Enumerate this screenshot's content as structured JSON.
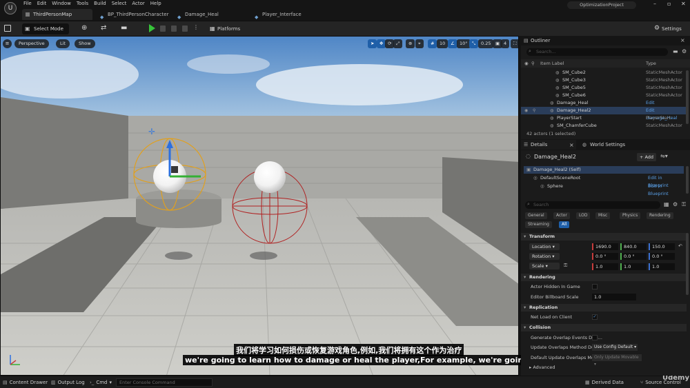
{
  "menu": [
    "File",
    "Edit",
    "Window",
    "Tools",
    "Build",
    "Select",
    "Actor",
    "Help"
  ],
  "map_tab": "ThirdPersonMap",
  "doc_tabs": [
    "BP_ThirdPersonCharacter",
    "Damage_Heal",
    "Player_Interface"
  ],
  "project_name": "OptimizationProject",
  "toolbar": {
    "select_mode": "Select Mode",
    "platforms": "Platforms",
    "settings": "Settings"
  },
  "viewport": {
    "view_mode": "Perspective",
    "lit": "Lit",
    "show": "Show",
    "grid_snap": "10",
    "rot_snap": "10°",
    "scale_snap": "0.25",
    "cam_speed": "4"
  },
  "subtitles": {
    "chinese": "我们将学习如何损伤或恢复游戏角色,例如,我们将拥有这个作为治疗",
    "english": "we're going to learn how to damage or heal the player,For example, we're going to h"
  },
  "statusbar": {
    "content_drawer": "Content Drawer",
    "output_log": "Output Log",
    "cmd": "Cmd",
    "console_placeholder": "Enter Console Command",
    "derived_data": "Derived Data",
    "source_control": "Source Control",
    "watermark": "Udemy"
  },
  "outliner": {
    "title": "Outliner",
    "search_placeholder": "Search...",
    "col_label": "Item Label",
    "col_type": "Type",
    "rows": [
      {
        "name": "SM_Cube2",
        "type": "StaticMeshActor",
        "indent": 2,
        "selected": false,
        "link": false
      },
      {
        "name": "SM_Cube3",
        "type": "StaticMeshActor",
        "indent": 2,
        "selected": false,
        "link": false
      },
      {
        "name": "SM_Cube5",
        "type": "StaticMeshActor",
        "indent": 2,
        "selected": false,
        "link": false
      },
      {
        "name": "SM_Cube6",
        "type": "StaticMeshActor",
        "indent": 2,
        "selected": false,
        "link": false
      },
      {
        "name": "Damage_Heal",
        "type": "Edit Damage_Heal",
        "indent": 1,
        "selected": false,
        "link": true
      },
      {
        "name": "Damage_Heal2",
        "type": "Edit Damage_Heal",
        "indent": 1,
        "selected": true,
        "link": true
      },
      {
        "name": "PlayerStart",
        "type": "PlayerStart",
        "indent": 1,
        "selected": false,
        "link": false
      },
      {
        "name": "SM_ChamferCube",
        "type": "StaticMeshActor",
        "indent": 1,
        "selected": false,
        "link": false
      }
    ],
    "count": "42 actors (1 selected)"
  },
  "details": {
    "tab_details": "Details",
    "tab_world": "World Settings",
    "actor_name": "Damage_Heal2",
    "add_label": "+ Add",
    "components": [
      {
        "name": "Damage_Heal2 (Self)",
        "bp": "",
        "indent": 0,
        "selected": true
      },
      {
        "name": "DefaultSceneRoot",
        "bp": "Edit in Blueprint",
        "indent": 1,
        "selected": false
      },
      {
        "name": "Sphere",
        "bp": "Edit in Blueprint",
        "indent": 2,
        "selected": false
      }
    ],
    "search_placeholder": "Search",
    "category_tabs_row1": [
      "General",
      "Actor",
      "LOD",
      "Misc",
      "Physics",
      "Rendering"
    ],
    "category_tabs_row2": [
      "Streaming",
      "All"
    ],
    "transform": {
      "title": "Transform",
      "location_label": "Location",
      "rotation_label": "Rotation",
      "scale_label": "Scale",
      "location": [
        "1690.0",
        "840.0",
        "150.0"
      ],
      "rotation": [
        "0.0 °",
        "0.0 °",
        "0.0 °"
      ],
      "scale": [
        "1.0",
        "1.0",
        "1.0"
      ]
    },
    "rendering": {
      "title": "Rendering",
      "hidden_label": "Actor Hidden In Game",
      "billboard_label": "Editor Billboard Scale",
      "billboard_value": "1.0"
    },
    "replication": {
      "title": "Replication",
      "net_load_label": "Net Load on Client"
    },
    "collision": {
      "title": "Collision",
      "gen_overlap_label": "Generate Overlap Events Duri...",
      "update_method_label": "Update Overlaps Method Duri...",
      "update_method_value": "Use Config Default",
      "default_update_label": "Default Update Overlaps Met...",
      "default_update_value": "Only Update Movable"
    },
    "advanced": "Advanced"
  },
  "colors": {
    "accent": "#1f5fa8",
    "selection": "#2a3d5a",
    "play_green": "#37c43a",
    "link_blue": "#5aa0e8",
    "gizmo_orange": "#e0a020",
    "trigger_red": "#b02020"
  }
}
